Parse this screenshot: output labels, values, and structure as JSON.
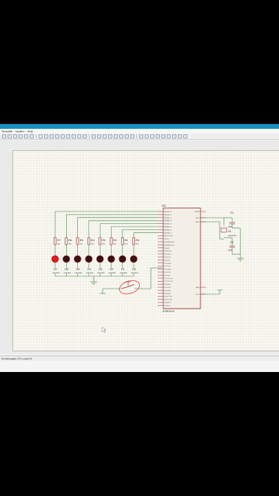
{
  "window": {
    "title": ""
  },
  "menubar": {
    "items": [
      "Template",
      "System",
      "Help"
    ]
  },
  "toolbar": {
    "button_count": 32
  },
  "schematic": {
    "mcu": {
      "ref": "U1",
      "part": "ATMEGA16",
      "pins_left": [
        "PA0/ADC0",
        "PA1/ADC1",
        "PA2/ADC2",
        "PA3/ADC3",
        "PA4/ADC4",
        "PA5/ADC5",
        "PA6/ADC6",
        "PA7/ADC7",
        "PB0/T0/XCK",
        "PB1/T1",
        "PB2/AIN0/INT2",
        "PB3/AIN1/OC0",
        "PB4/SS",
        "PB5/MOSI",
        "PB6/MISO",
        "PB7/SCK",
        "PC0/SCL",
        "PC1/SDA",
        "PC2/TCK",
        "PC3/TMS",
        "PC4/TDO",
        "PC5/TDI",
        "PC6/TOSC1",
        "PC7/TOSC2",
        "PD0/RXD",
        "PD1/TXD",
        "PD2/INT0",
        "PD3/INT1",
        "PD4/OC1B",
        "PD5/OC1A",
        "PD6/ICP1",
        "PD7/OC2"
      ],
      "pins_right": [
        "RESET",
        "XTAL1",
        "XTAL2",
        "AREF",
        "AVCC"
      ]
    },
    "resistors": [
      {
        "ref": "R7",
        "value": "330"
      },
      {
        "ref": "R6",
        "value": "330"
      },
      {
        "ref": "R5",
        "value": "330"
      },
      {
        "ref": "R4",
        "value": "330"
      },
      {
        "ref": "R3",
        "value": "330"
      },
      {
        "ref": "R2",
        "value": "330"
      },
      {
        "ref": "R1",
        "value": "330"
      },
      {
        "ref": "R0",
        "value": "330"
      }
    ],
    "leds": [
      {
        "ref": "D7",
        "part": "LED-RED",
        "lit": true
      },
      {
        "ref": "D6",
        "part": "LED-RED",
        "lit": false
      },
      {
        "ref": "D5",
        "part": "LED-RED",
        "lit": false
      },
      {
        "ref": "D4",
        "part": "LED-RED",
        "lit": false
      },
      {
        "ref": "D3",
        "part": "LED-RED",
        "lit": false
      },
      {
        "ref": "D2",
        "part": "LED-RED",
        "lit": false
      },
      {
        "ref": "D1",
        "part": "LED-RED",
        "lit": false
      },
      {
        "ref": "D0",
        "part": "LED-RED",
        "lit": false
      }
    ],
    "caps": [
      {
        "ref": "C1",
        "value": "22pF"
      },
      {
        "ref": "C2",
        "value": "22pF"
      }
    ],
    "crystal": {
      "ref": "X1",
      "value": "CRYSTAL"
    },
    "switch": {
      "ref": ""
    },
    "colors": {
      "wire": "#2f7a2f",
      "component": "#8b1d1d",
      "led_lit": "#e31b1b",
      "led_off": "#3a1010",
      "annotation": "#e23030",
      "body": "#f3efe7"
    }
  },
  "statusbar": {
    "left": "No Messages  CPU Load 0%",
    "mid": "",
    "coords": ""
  }
}
